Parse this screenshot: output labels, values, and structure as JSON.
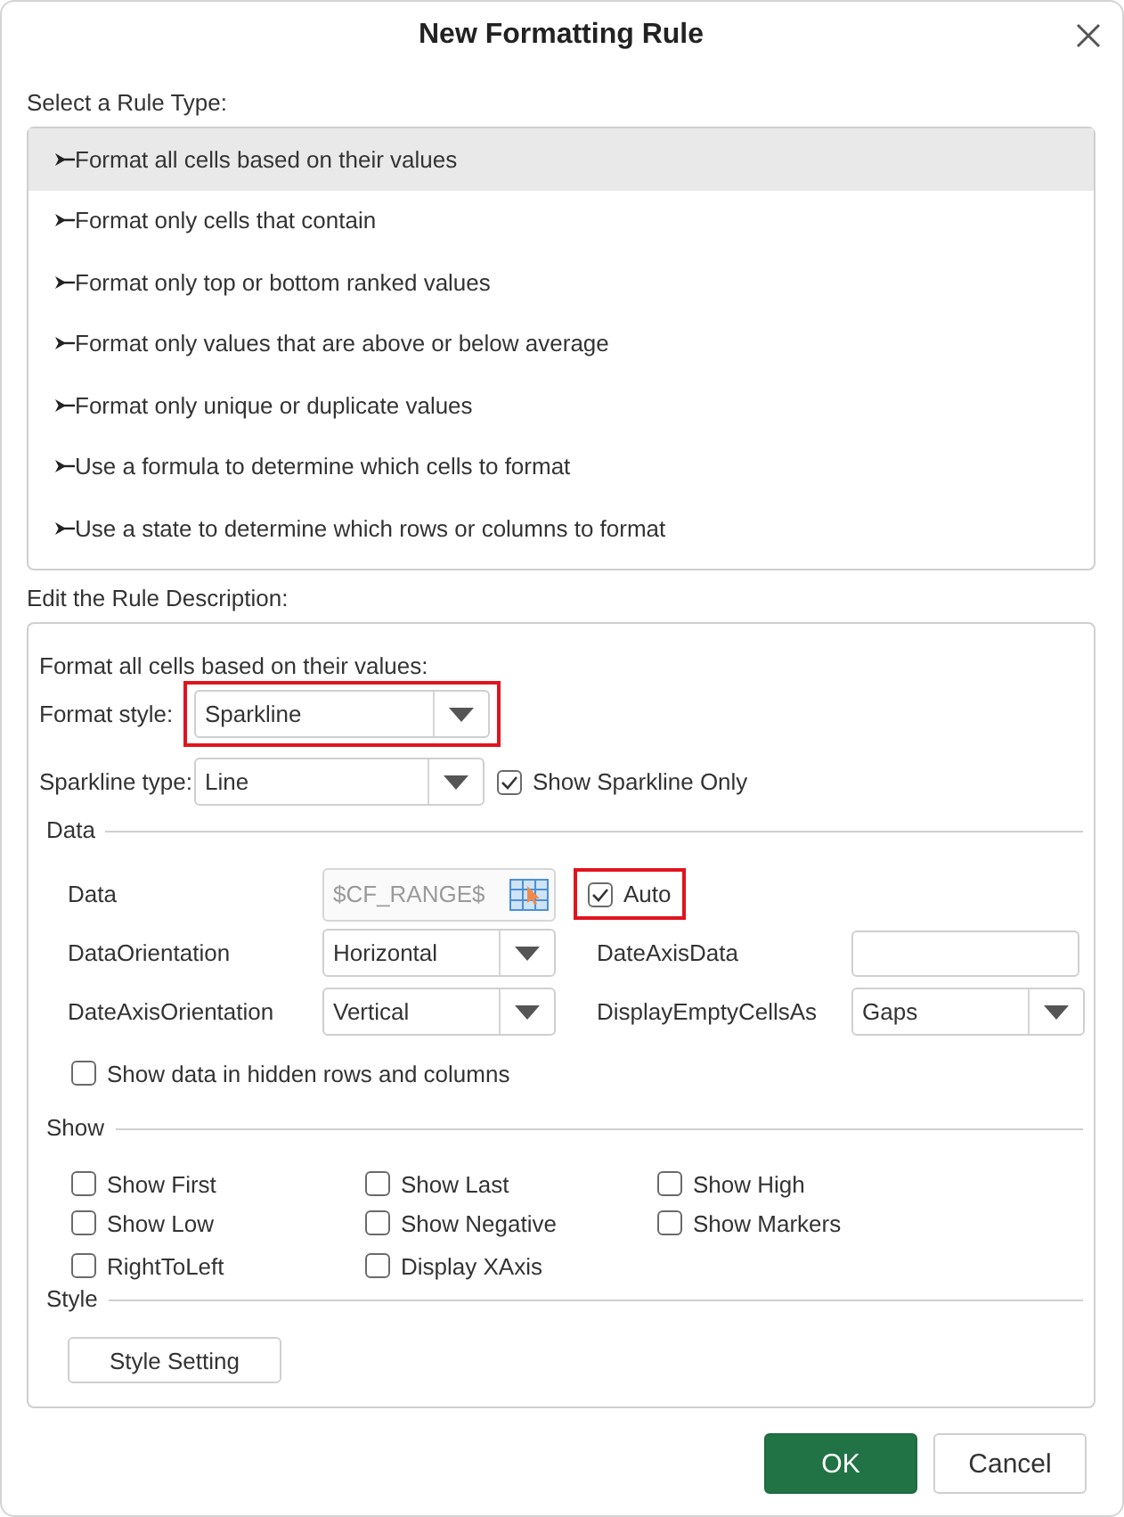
{
  "window": {
    "title": "New Formatting Rule"
  },
  "rule_types": {
    "label": "Select a Rule Type:",
    "items": [
      {
        "label": "Format all cells based on their values",
        "selected": true
      },
      {
        "label": "Format only cells that contain",
        "selected": false
      },
      {
        "label": "Format only top or bottom ranked values",
        "selected": false
      },
      {
        "label": "Format only values that are above or below average",
        "selected": false
      },
      {
        "label": "Format only unique or duplicate values",
        "selected": false
      },
      {
        "label": "Use a formula to determine which cells to format",
        "selected": false
      },
      {
        "label": "Use a state to determine which rows or columns to format",
        "selected": false
      }
    ]
  },
  "description": {
    "label": "Edit the Rule Description:",
    "heading": "Format all cells based on their values:",
    "format_style": {
      "label": "Format style:",
      "value": "Sparkline",
      "highlighted": true
    },
    "sparkline_type": {
      "label": "Sparkline type:",
      "value": "Line"
    },
    "show_sparkline_only": {
      "label": "Show Sparkline Only",
      "checked": true
    },
    "data_group": {
      "title": "Data",
      "data": {
        "label": "Data",
        "value": "$CF_RANGE$",
        "disabled": true
      },
      "auto": {
        "label": "Auto",
        "checked": true,
        "highlighted": true
      },
      "fields": [
        {
          "kind": "dropdown",
          "label": "DataOrientation",
          "value": "Horizontal"
        },
        {
          "kind": "input",
          "label": "DateAxisData"
        },
        {
          "kind": "dropdown",
          "label": "DateAxisOrientation",
          "value": "Vertical"
        },
        {
          "kind": "dropdown",
          "label": "DisplayEmptyCellsAs",
          "value": "Gaps"
        }
      ],
      "hidden_rows": {
        "label": "Show data in hidden rows and columns",
        "checked": false
      }
    },
    "show_group": {
      "title": "Show",
      "options": [
        {
          "label": "Show First",
          "checked": false
        },
        {
          "label": "Show Last",
          "checked": false
        },
        {
          "label": "Show High",
          "checked": false
        },
        {
          "label": "Show Low",
          "checked": false
        },
        {
          "label": "Show Negative",
          "checked": false
        },
        {
          "label": "Show Markers",
          "checked": false
        },
        {
          "label": "RightToLeft",
          "checked": false
        },
        {
          "label": "Display XAxis",
          "checked": false
        }
      ]
    },
    "style_group": {
      "title": "Style",
      "button": "Style Setting"
    }
  },
  "buttons": [
    {
      "label": "OK",
      "kind": "primary"
    },
    {
      "label": "Cancel",
      "kind": "secondary"
    }
  ]
}
